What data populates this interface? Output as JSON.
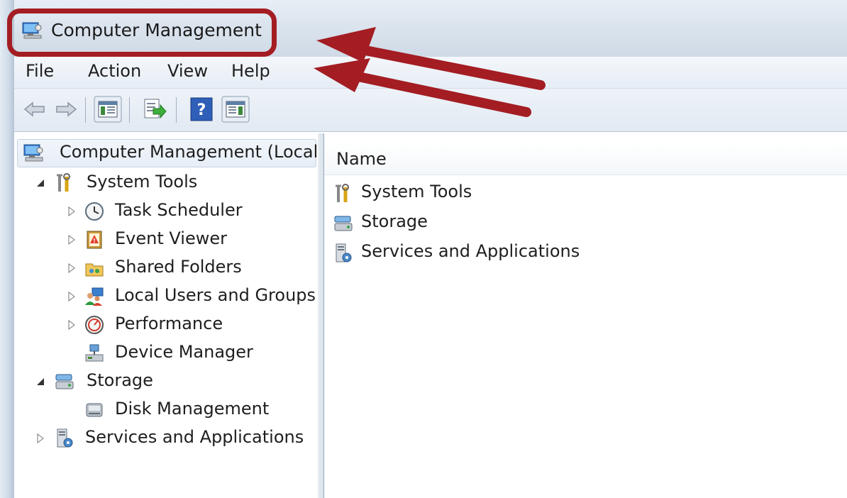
{
  "window": {
    "title": "Computer Management"
  },
  "menu": [
    "File",
    "Action",
    "View",
    "Help"
  ],
  "toolbar": {
    "buttons": [
      {
        "name": "back-arrow-icon"
      },
      {
        "name": "forward-arrow-icon"
      },
      {
        "name": "show-hide-console-tree-icon"
      },
      {
        "name": "export-list-icon"
      },
      {
        "name": "help-icon"
      },
      {
        "name": "show-hide-action-pane-icon"
      }
    ]
  },
  "tree": {
    "root": "Computer Management (Local",
    "items": [
      {
        "label": "System Tools",
        "level": 1,
        "expanded": true,
        "icon": "tools-icon"
      },
      {
        "label": "Task Scheduler",
        "level": 2,
        "expanded": false,
        "icon": "clock-icon"
      },
      {
        "label": "Event Viewer",
        "level": 2,
        "expanded": false,
        "icon": "event-viewer-icon"
      },
      {
        "label": "Shared Folders",
        "level": 2,
        "expanded": false,
        "icon": "shared-folder-icon"
      },
      {
        "label": "Local Users and Groups",
        "level": 2,
        "expanded": false,
        "icon": "users-icon"
      },
      {
        "label": "Performance",
        "level": 2,
        "expanded": false,
        "icon": "performance-icon"
      },
      {
        "label": "Device Manager",
        "level": 2,
        "expanded": null,
        "icon": "device-manager-icon"
      },
      {
        "label": "Storage",
        "level": 1,
        "expanded": true,
        "icon": "storage-icon"
      },
      {
        "label": "Disk Management",
        "level": 2,
        "expanded": null,
        "icon": "disk-icon"
      },
      {
        "label": "Services and Applications",
        "level": 1,
        "expanded": false,
        "icon": "services-icon"
      }
    ]
  },
  "list": {
    "column_header": "Name",
    "rows": [
      {
        "label": "System Tools",
        "icon": "tools-icon"
      },
      {
        "label": "Storage",
        "icon": "storage-icon"
      },
      {
        "label": "Services and Applications",
        "icon": "services-icon"
      }
    ]
  },
  "colors": {
    "annotation": "#a31d23",
    "selection": "#e6edf6"
  }
}
